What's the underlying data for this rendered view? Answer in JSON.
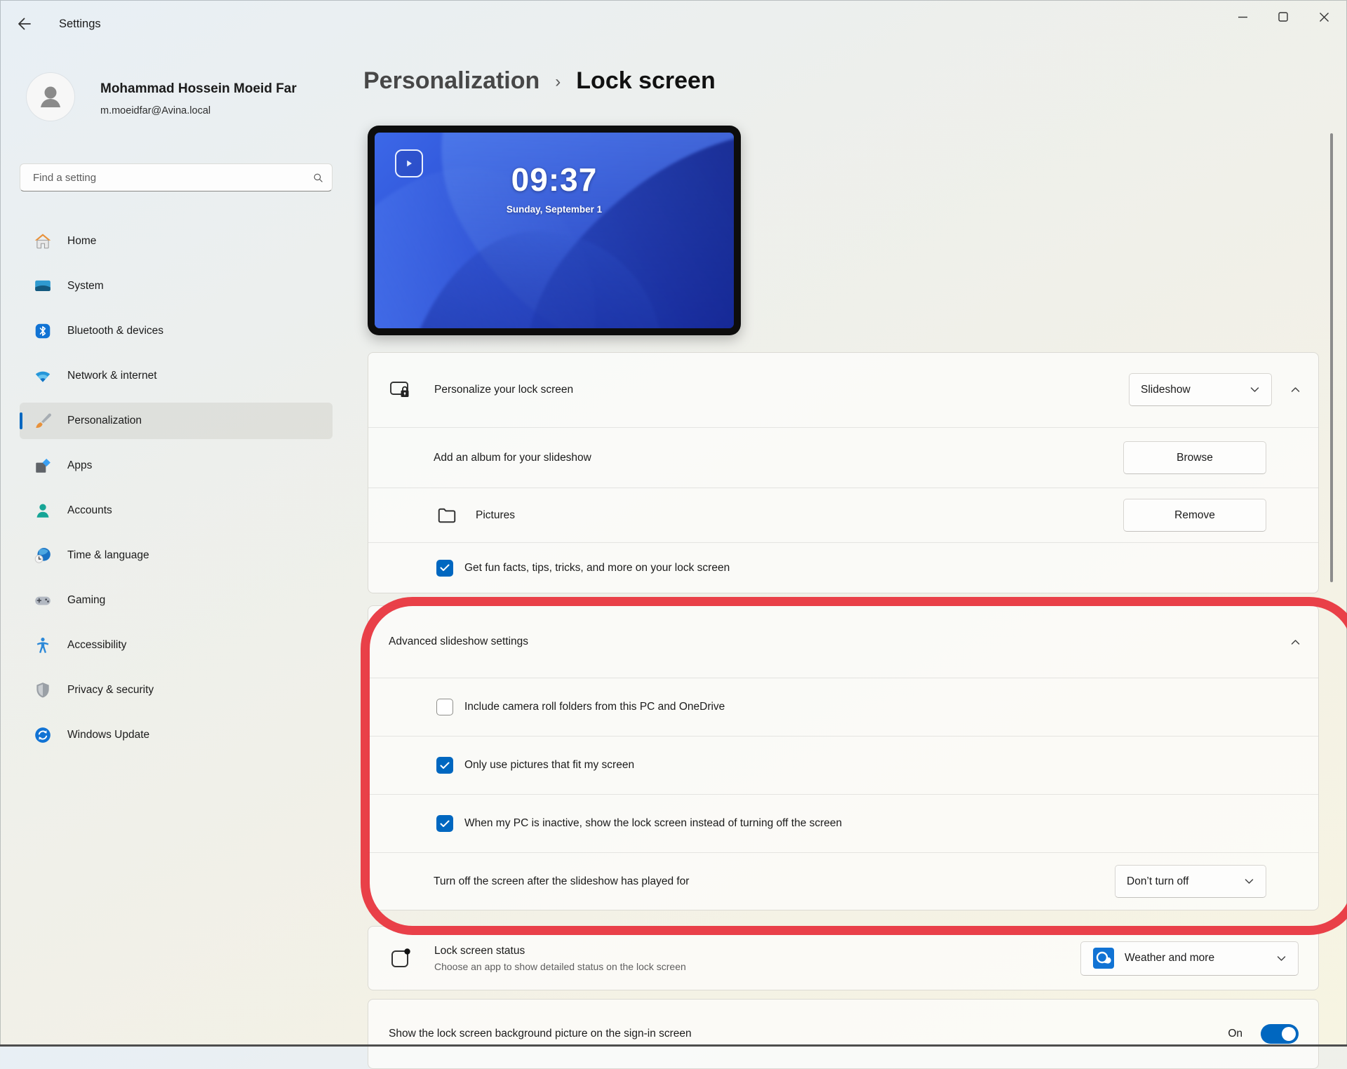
{
  "window": {
    "title": "Settings"
  },
  "user": {
    "name": "Mohammad Hossein Moeid Far",
    "email": "m.moeidfar@Avina.local"
  },
  "search": {
    "placeholder": "Find a setting"
  },
  "sidebar": {
    "items": [
      {
        "label": "Home",
        "icon": "home-icon",
        "selected": false
      },
      {
        "label": "System",
        "icon": "system-icon",
        "selected": false
      },
      {
        "label": "Bluetooth & devices",
        "icon": "bluetooth-icon",
        "selected": false
      },
      {
        "label": "Network & internet",
        "icon": "network-icon",
        "selected": false
      },
      {
        "label": "Personalization",
        "icon": "personalization-icon",
        "selected": true
      },
      {
        "label": "Apps",
        "icon": "apps-icon",
        "selected": false
      },
      {
        "label": "Accounts",
        "icon": "accounts-icon",
        "selected": false
      },
      {
        "label": "Time & language",
        "icon": "time-language-icon",
        "selected": false
      },
      {
        "label": "Gaming",
        "icon": "gaming-icon",
        "selected": false
      },
      {
        "label": "Accessibility",
        "icon": "accessibility-icon",
        "selected": false
      },
      {
        "label": "Privacy & security",
        "icon": "privacy-security-icon",
        "selected": false
      },
      {
        "label": "Windows Update",
        "icon": "windows-update-icon",
        "selected": false
      }
    ]
  },
  "breadcrumb": {
    "parent": "Personalization",
    "separator": "›",
    "current": "Lock screen"
  },
  "preview": {
    "time": "09:37",
    "date": "Sunday, September 1"
  },
  "personalize_card": {
    "title": "Personalize your lock screen",
    "dropdown_value": "Slideshow",
    "album_row": {
      "label": "Add an album for your slideshow",
      "button": "Browse"
    },
    "folder_row": {
      "label": "Pictures",
      "button": "Remove"
    },
    "fun_facts_row": {
      "label": "Get fun facts, tips, tricks, and more on your lock screen",
      "checked": true
    }
  },
  "advanced_card": {
    "title": "Advanced slideshow settings",
    "checkbox_rows": [
      {
        "label": "Include camera roll folders from this PC and OneDrive",
        "checked": false
      },
      {
        "label": "Only use pictures that fit my screen",
        "checked": true
      },
      {
        "label": "When my PC is inactive, show the lock screen instead of turning off the screen",
        "checked": true
      }
    ],
    "turn_off_row": {
      "label": "Turn off the screen after the slideshow has played for",
      "dropdown_value": "Don’t turn off"
    }
  },
  "status_card": {
    "title": "Lock screen status",
    "subtitle": "Choose an app to show detailed status on the lock screen",
    "dropdown_value": "Weather and more"
  },
  "signin_card": {
    "label": "Show the lock screen background picture on the sign-in screen",
    "toggle_label": "On",
    "toggle_state": "on"
  },
  "colors": {
    "accent": "#0067c0",
    "annotation_red": "#e8363f"
  }
}
